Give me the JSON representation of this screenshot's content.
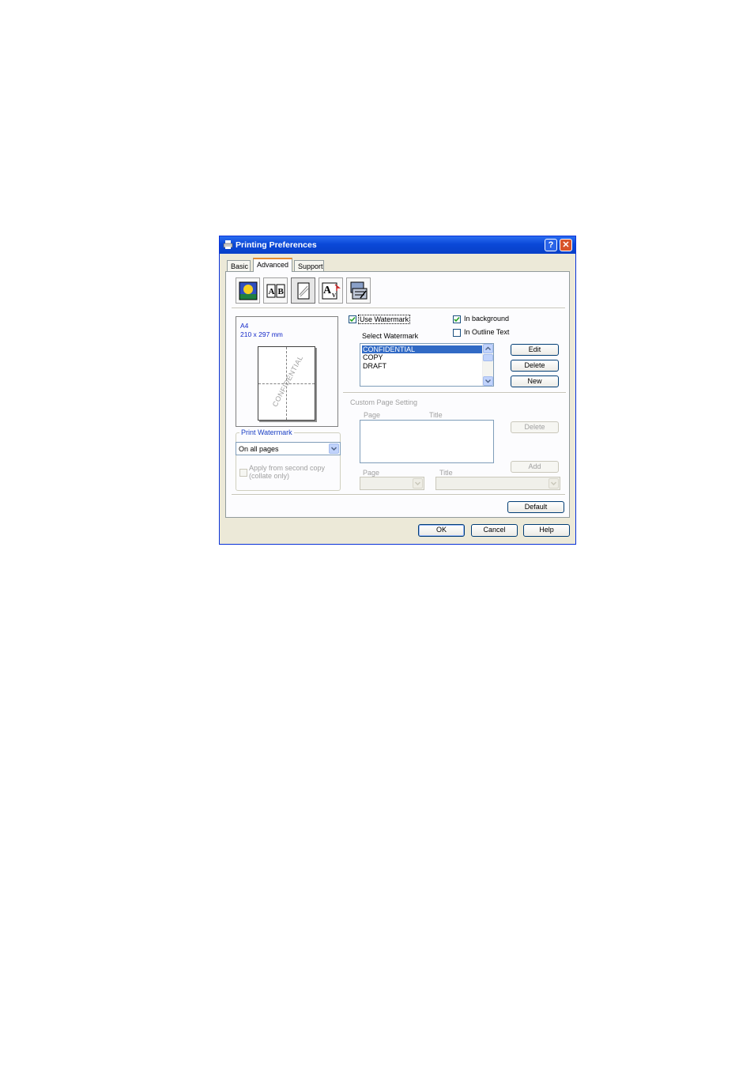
{
  "window": {
    "title": "Printing Preferences",
    "help_label": "?",
    "close_label": "✕"
  },
  "tabs": [
    {
      "label": "Basic"
    },
    {
      "label": "Advanced"
    },
    {
      "label": "Support"
    }
  ],
  "toolbar_icons": [
    "print-quality-icon",
    "duplex-icon",
    "watermark-icon",
    "scaling-icon",
    "device-options-icon"
  ],
  "preview": {
    "paper_size": "A4",
    "paper_dims": "210 x 297 mm",
    "watermark_text": "CONFIDENTIAL"
  },
  "print_watermark": {
    "group_label": "Print Watermark",
    "selected": "On all pages",
    "apply_second_copy_label_1": "Apply from second copy",
    "apply_second_copy_label_2": "(collate only)"
  },
  "watermark": {
    "use_watermark_label": "Use Watermark",
    "use_watermark_checked": true,
    "in_background_label": "In background",
    "in_background_checked": true,
    "in_outline_label": "In Outline Text",
    "in_outline_checked": false,
    "select_label": "Select Watermark",
    "items": [
      "CONFIDENTIAL",
      "COPY",
      "DRAFT"
    ],
    "selected_index": 0,
    "edit_label": "Edit",
    "delete_label": "Delete",
    "new_label": "New"
  },
  "custom_page": {
    "group_label": "Custom Page Setting",
    "page_header": "Page",
    "title_header": "Title",
    "delete_label": "Delete",
    "add_label": "Add",
    "page_label": "Page",
    "title_label": "Title"
  },
  "footer": {
    "default_label": "Default",
    "ok_label": "OK",
    "cancel_label": "Cancel",
    "help_label": "Help"
  }
}
